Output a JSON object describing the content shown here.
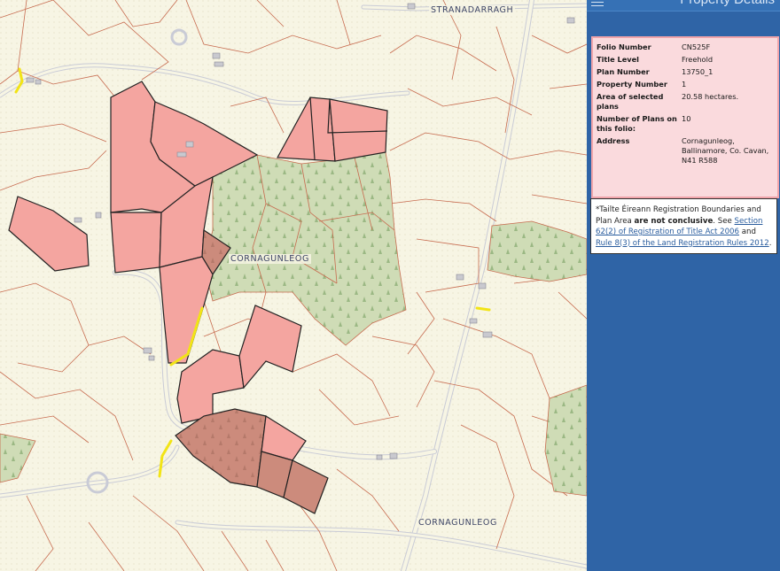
{
  "map": {
    "place_labels": [
      {
        "id": "stranadarragh",
        "text": "STRANADARRAGH"
      },
      {
        "id": "cornagunleog-centre",
        "text": "CORNAGUNLEOG"
      },
      {
        "id": "cornagunleog-south",
        "text": "CORNAGUNLEOG"
      }
    ],
    "colors": {
      "background": "#f7f5e4",
      "field_boundary": "#c76b4f",
      "selected_plot_fill": "#f4a5a0",
      "selected_plot_stroke": "#222222",
      "forest_fill": "#cfdcb6",
      "highlight_line": "#f2e416",
      "road": "#c9cbd6"
    }
  },
  "panel": {
    "title": "Property Details",
    "menu_icon": "hamburger-menu-icon",
    "details": [
      {
        "label": "Folio Number",
        "value": "CN525F"
      },
      {
        "label": "Title Level",
        "value": "Freehold"
      },
      {
        "label": "Plan Number",
        "value": "13750_1"
      },
      {
        "label": "Property Number",
        "value": "1"
      },
      {
        "label": "Area of selected plans",
        "value": "20.58 hectares."
      },
      {
        "label": "Number of Plans on this folio:",
        "value": "10"
      },
      {
        "label": "Address",
        "value": "Cornagunleog, Ballinamore, Co. Cavan, N41 R588"
      }
    ],
    "note": {
      "part1": "*Tailte Éireann Registration Boundaries and Plan Area ",
      "bold": "are not conclusive",
      "part2": ". See ",
      "link1": "Section 62(2) of Registration of Title Act 2006",
      "part3": " and ",
      "link2": "Rule 8(3) of the Land Registration Rules 2012",
      "part4": "."
    }
  }
}
